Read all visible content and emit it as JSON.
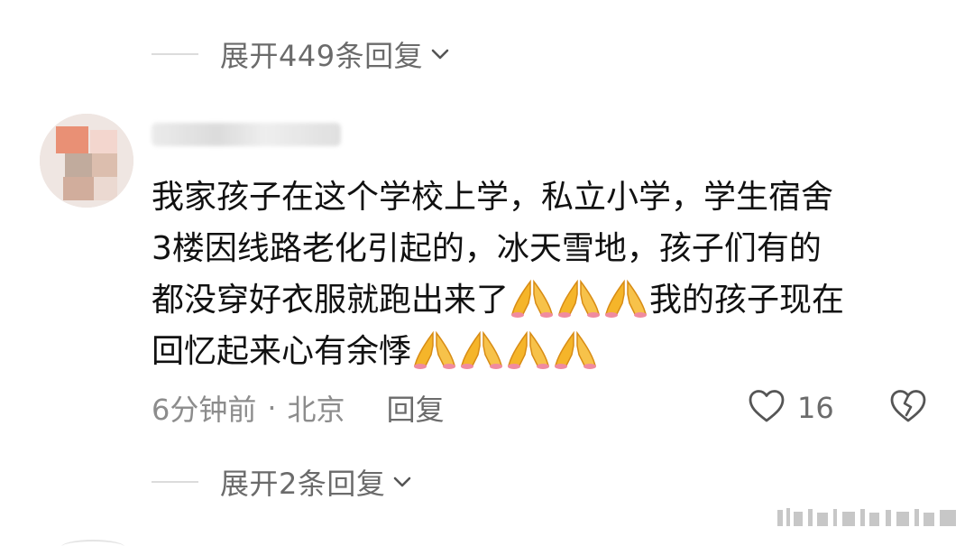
{
  "replies_top": {
    "label": "展开449条回复"
  },
  "comment": {
    "line1": "我家孩子在这个学校上学，私立小学，学生宿舍",
    "line2": "3楼因线路老化引起的，冰天雪地，孩子们有的",
    "line3_prefix": "都没穿好衣服就跑出来了",
    "line3_suffix": "我的孩子现在",
    "line4_prefix": "回忆起来心有余悸",
    "time": "6分钟前",
    "separator": "·",
    "location": "北京",
    "reply_label": "回复",
    "like_count": "16"
  },
  "replies_bottom": {
    "label": "展开2条回复"
  },
  "icons": {
    "expand": "chevron-down-icon",
    "like": "heart-outline-icon",
    "dislike": "broken-heart-icon",
    "emoji": "folded-hands-emoji"
  },
  "colors": {
    "text": "#111111",
    "secondary_text": "#8c8c8c",
    "divider": "#dcdcdc",
    "emoji": "#f5b52a"
  }
}
